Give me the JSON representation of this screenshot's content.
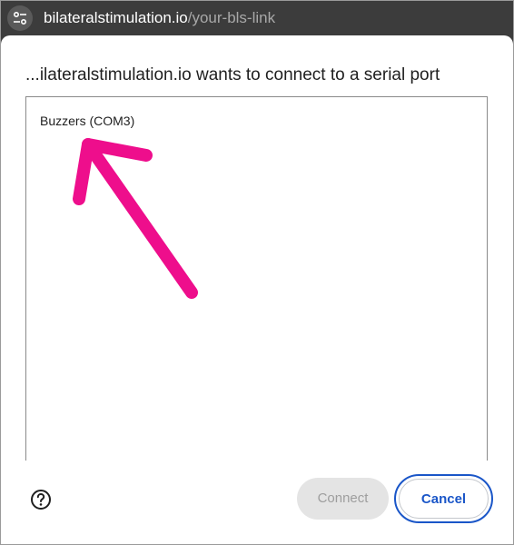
{
  "urlbar": {
    "site_info_icon": "tune-icon",
    "domain": "bilateralstimulation.io",
    "path": "/your-bls-link"
  },
  "dialog": {
    "title": "...ilateralstimulation.io wants to connect to a serial port",
    "ports": [
      {
        "label": "Buzzers (COM3)"
      }
    ],
    "annotation_icon": "arrow-icon",
    "annotation_color": "#ee0e8c",
    "help_icon": "help-icon",
    "buttons": {
      "connect_label": "Connect",
      "cancel_label": "Cancel"
    }
  },
  "colors": {
    "accent": "#1a56c8",
    "chrome_bg": "#3c3c3c",
    "disabled_bg": "#e4e4e4"
  }
}
